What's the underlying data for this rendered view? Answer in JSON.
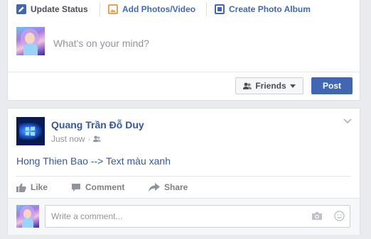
{
  "composer": {
    "tabs": [
      {
        "label": "Update Status",
        "icon": "pencil-icon"
      },
      {
        "label": "Add Photos/Video",
        "icon": "photo-icon"
      },
      {
        "label": "Create Photo Album",
        "icon": "album-icon"
      }
    ],
    "placeholder": "What's on your mind?",
    "audience_label": "Friends",
    "post_label": "Post"
  },
  "post": {
    "author": "Quang Trần Đỗ Duy",
    "time": "Just now",
    "separator": "·",
    "text": "Hong Thien Bao --> Text màu xanh",
    "actions": [
      {
        "label": "Like",
        "icon": "thumbs-up-icon"
      },
      {
        "label": "Comment",
        "icon": "comment-icon"
      },
      {
        "label": "Share",
        "icon": "share-icon"
      }
    ],
    "comment_placeholder": "Write a comment..."
  },
  "colors": {
    "brand_blue": "#4267b2",
    "link_blue": "#365899",
    "background": "#e9ebee"
  }
}
